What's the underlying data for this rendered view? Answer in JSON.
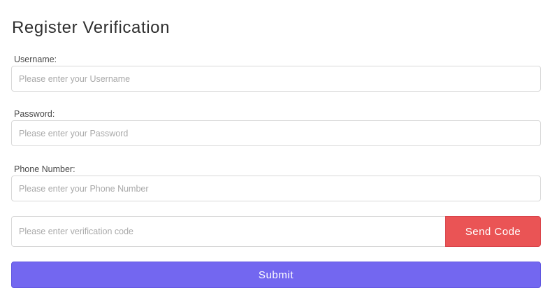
{
  "form": {
    "title": "Register Verification",
    "username": {
      "label": "Username:",
      "placeholder": "Please enter your Username",
      "value": ""
    },
    "password": {
      "label": "Password:",
      "placeholder": "Please enter your Password",
      "value": ""
    },
    "phone": {
      "label": "Phone Number:",
      "placeholder": "Please enter your Phone Number",
      "value": ""
    },
    "verification": {
      "placeholder": "Please enter verification code",
      "value": "",
      "send_code_label": "Send Code"
    },
    "submit_label": "Submit"
  },
  "colors": {
    "send_code_bg": "#ea5455",
    "submit_bg": "#7367f0",
    "input_border": "#d8d8d8",
    "placeholder_text": "#a9a9a9"
  }
}
